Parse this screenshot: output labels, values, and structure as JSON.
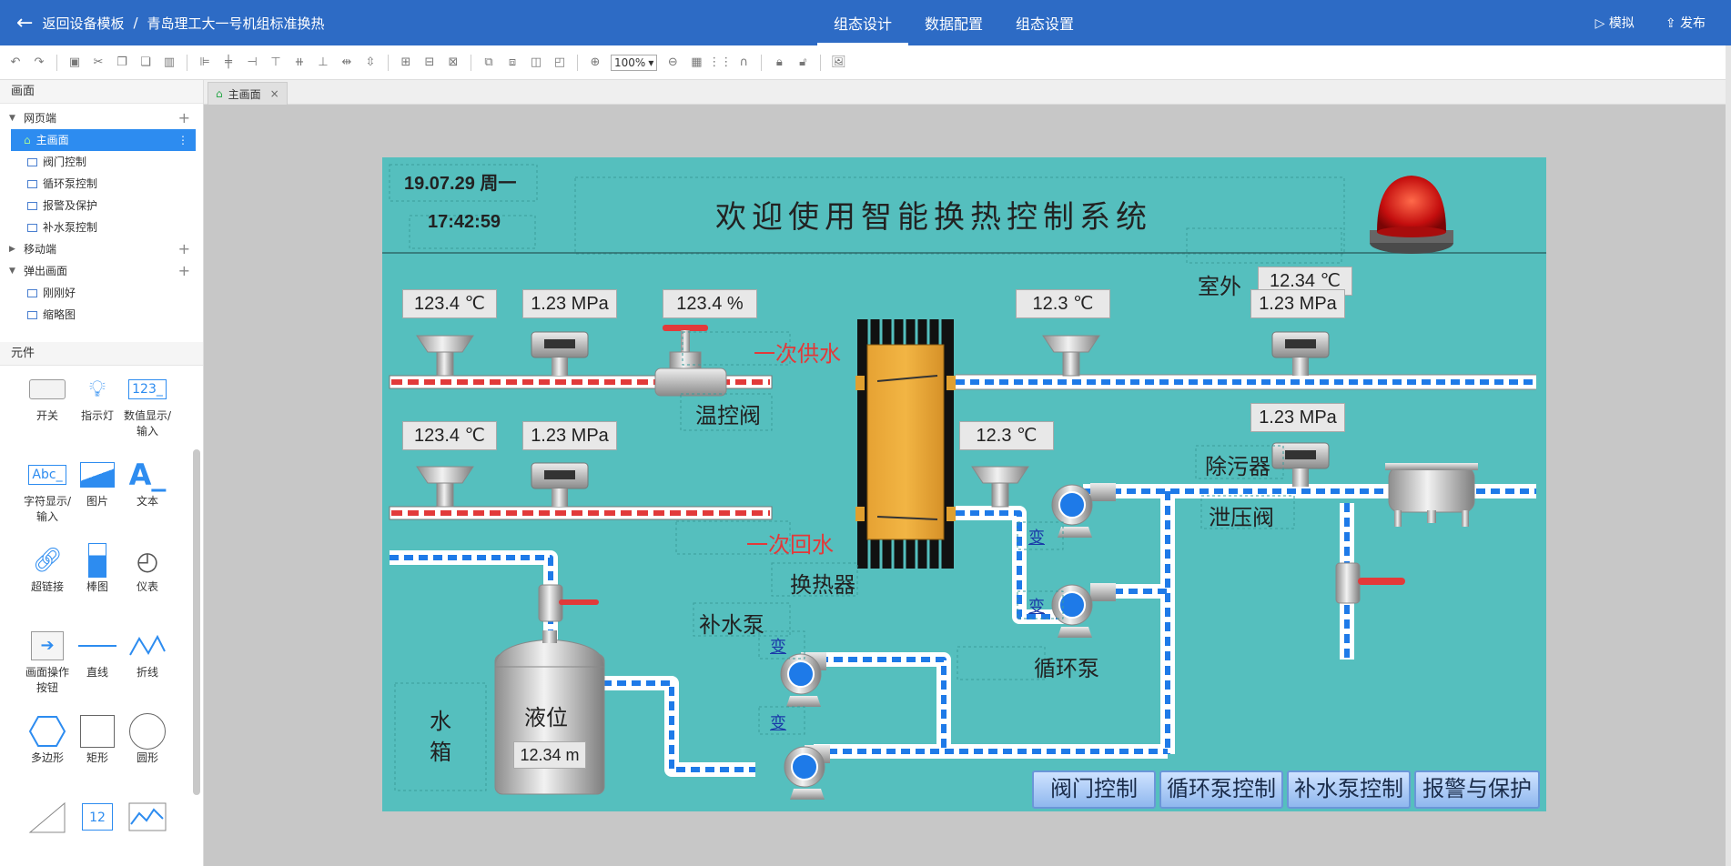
{
  "header": {
    "back_label": "返回设备模板",
    "separator": "/",
    "project": "青岛理工大一号机组标准换热",
    "tabs": [
      {
        "label": "组态设计"
      },
      {
        "label": "数据配置"
      },
      {
        "label": "组态设置"
      }
    ],
    "simulate": "模拟",
    "publish": "发布"
  },
  "toolbar": {
    "zoom": "100%"
  },
  "left": {
    "screens_title": "画面",
    "tree": [
      {
        "label": "网页端"
      },
      {
        "label": "主画面"
      },
      {
        "label": "阀门控制"
      },
      {
        "label": "循环泵控制"
      },
      {
        "label": "报警及保护"
      },
      {
        "label": "补水泵控制"
      },
      {
        "label": "移动端"
      },
      {
        "label": "弹出画面"
      },
      {
        "label": "刚刚好"
      },
      {
        "label": "缩略图"
      }
    ],
    "components_title": "元件",
    "components": [
      {
        "label": "开关"
      },
      {
        "label": "指示灯"
      },
      {
        "label": "数值显示/输入"
      },
      {
        "label": "字符显示/输入"
      },
      {
        "label": "图片"
      },
      {
        "label": "文本"
      },
      {
        "label": "超链接"
      },
      {
        "label": "棒图"
      },
      {
        "label": "仪表"
      },
      {
        "label": "画面操作按钮"
      },
      {
        "label": "直线"
      },
      {
        "label": "折线"
      },
      {
        "label": "多边形"
      },
      {
        "label": "矩形"
      },
      {
        "label": "圆形"
      }
    ],
    "icon_texts": {
      "numeric": "123_",
      "text": "Abc_",
      "letter": "A_",
      "calendar": "12"
    }
  },
  "page_tab": {
    "label": "主画面"
  },
  "screen": {
    "date": "19.07.29 周一",
    "time": "17:42:59",
    "title": "欢迎使用智能换热控制系统",
    "outdoor_label": "室外",
    "outdoor_temp": "12.34 ℃",
    "t1": "123.4 ℃",
    "p1": "1.23 MPa",
    "pct": "123.4 %",
    "t2": "12.3 ℃",
    "p2": "1.23 MPa",
    "t3": "123.4 ℃",
    "p3": "1.23 MPa",
    "t4": "12.3 ℃",
    "p4": "1.23 MPa",
    "supply": "一次供水",
    "return": "一次回水",
    "valve": "温控阀",
    "hex": "换热器",
    "makeup_pump": "补水泵",
    "circ_pump": "循环泵",
    "desilter": "除污器",
    "relief": "泄压阀",
    "tank_l1": "水",
    "tank_l2": "箱",
    "level_label": "液位",
    "level_value": "12.34 m",
    "vfd": "变",
    "nav": [
      {
        "label": "阀门控制"
      },
      {
        "label": "循环泵控制"
      },
      {
        "label": "补水泵控制"
      },
      {
        "label": "报警与保护"
      }
    ]
  }
}
